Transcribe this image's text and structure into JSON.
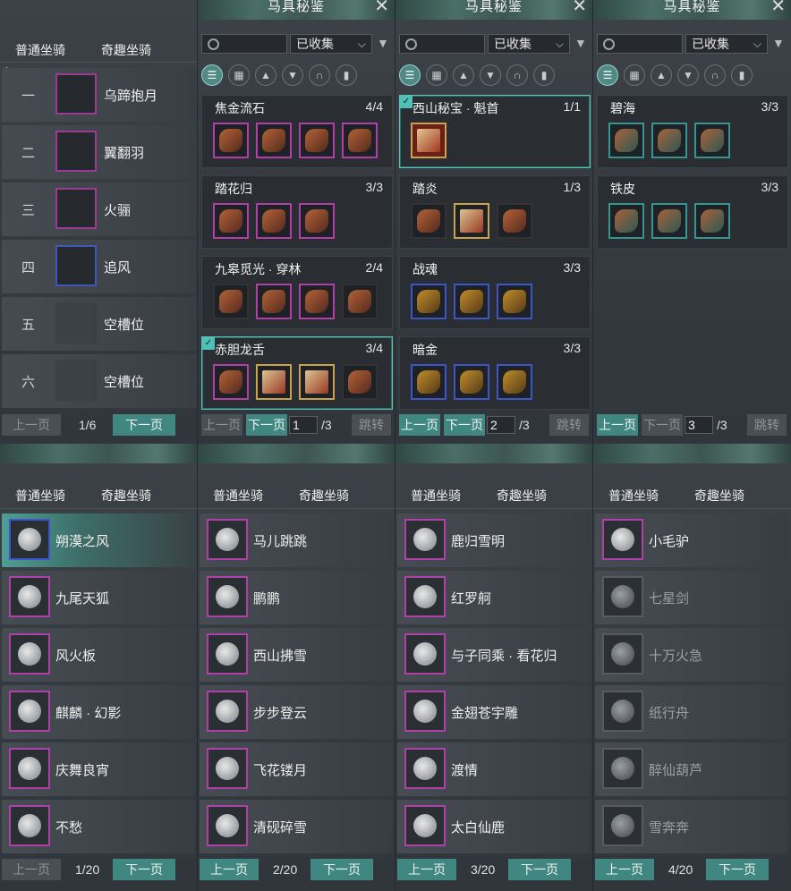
{
  "colors": {
    "accent": "#3f8780",
    "select_border": "#5cc3b8",
    "purple_rarity": "#b13fa8",
    "blue_rarity": "#3c56c9",
    "teal_rarity": "#37948f"
  },
  "top_left": {
    "tabs": [
      "普通坐骑",
      "奇趣坐骑"
    ],
    "slots": [
      {
        "num": "一",
        "name": "乌蹄抱月"
      },
      {
        "num": "二",
        "name": "翼翻羽"
      },
      {
        "num": "三",
        "name": "火骊"
      },
      {
        "num": "四",
        "name": "追风"
      },
      {
        "num": "五",
        "name": "空槽位"
      },
      {
        "num": "六",
        "name": "空槽位"
      }
    ],
    "prev": "上一页",
    "page": "1/6",
    "next": "下一页"
  },
  "codex": {
    "title": "马具秘鉴",
    "close": "✕",
    "filter_value": "已收集",
    "prev": "上一页",
    "next": "下一页",
    "jump": "跳转",
    "total": "/3",
    "panels": [
      {
        "page_input": "1",
        "sets": [
          {
            "name": "焦金流石",
            "count": "4/4"
          },
          {
            "name": "踏花归",
            "count": "3/3"
          },
          {
            "name": "九皋觅光 · 穿林",
            "count": "2/4"
          },
          {
            "name": "赤胆龙舌",
            "count": "3/4"
          }
        ]
      },
      {
        "page_input": "2",
        "sets": [
          {
            "name": "西山秘宝 · 魁首",
            "count": "1/1"
          },
          {
            "name": "踏炎",
            "count": "1/3"
          },
          {
            "name": "战魂",
            "count": "3/3"
          },
          {
            "name": "暗金",
            "count": "3/3"
          }
        ]
      },
      {
        "page_input": "3",
        "sets": [
          {
            "name": "碧海",
            "count": "3/3"
          },
          {
            "name": "铁皮",
            "count": "3/3"
          }
        ]
      }
    ]
  },
  "bottom": {
    "tabs": [
      "普通坐骑",
      "奇趣坐骑"
    ],
    "prev": "上一页",
    "next": "下一页",
    "lists": [
      {
        "page": "1/20",
        "items": [
          "朔漠之风",
          "九尾天狐",
          "风火板",
          "麒麟 · 幻影",
          "庆舞良宵",
          "不愁"
        ]
      },
      {
        "page": "2/20",
        "items": [
          "马儿跳跳",
          "鹏鹏",
          "西山拂雪",
          "步步登云",
          "飞花镂月",
          "清砚碎雪"
        ]
      },
      {
        "page": "3/20",
        "items": [
          "鹿归雪明",
          "红罗舸",
          "与子同乘 · 看花归",
          "金翅苍宇雕",
          "渡情",
          "太白仙鹿"
        ]
      },
      {
        "page": "4/20",
        "items": [
          "小毛驴",
          "七星剑",
          "十万火急",
          "纸行舟",
          "醉仙葫芦",
          "雪奔奔"
        ]
      }
    ]
  }
}
